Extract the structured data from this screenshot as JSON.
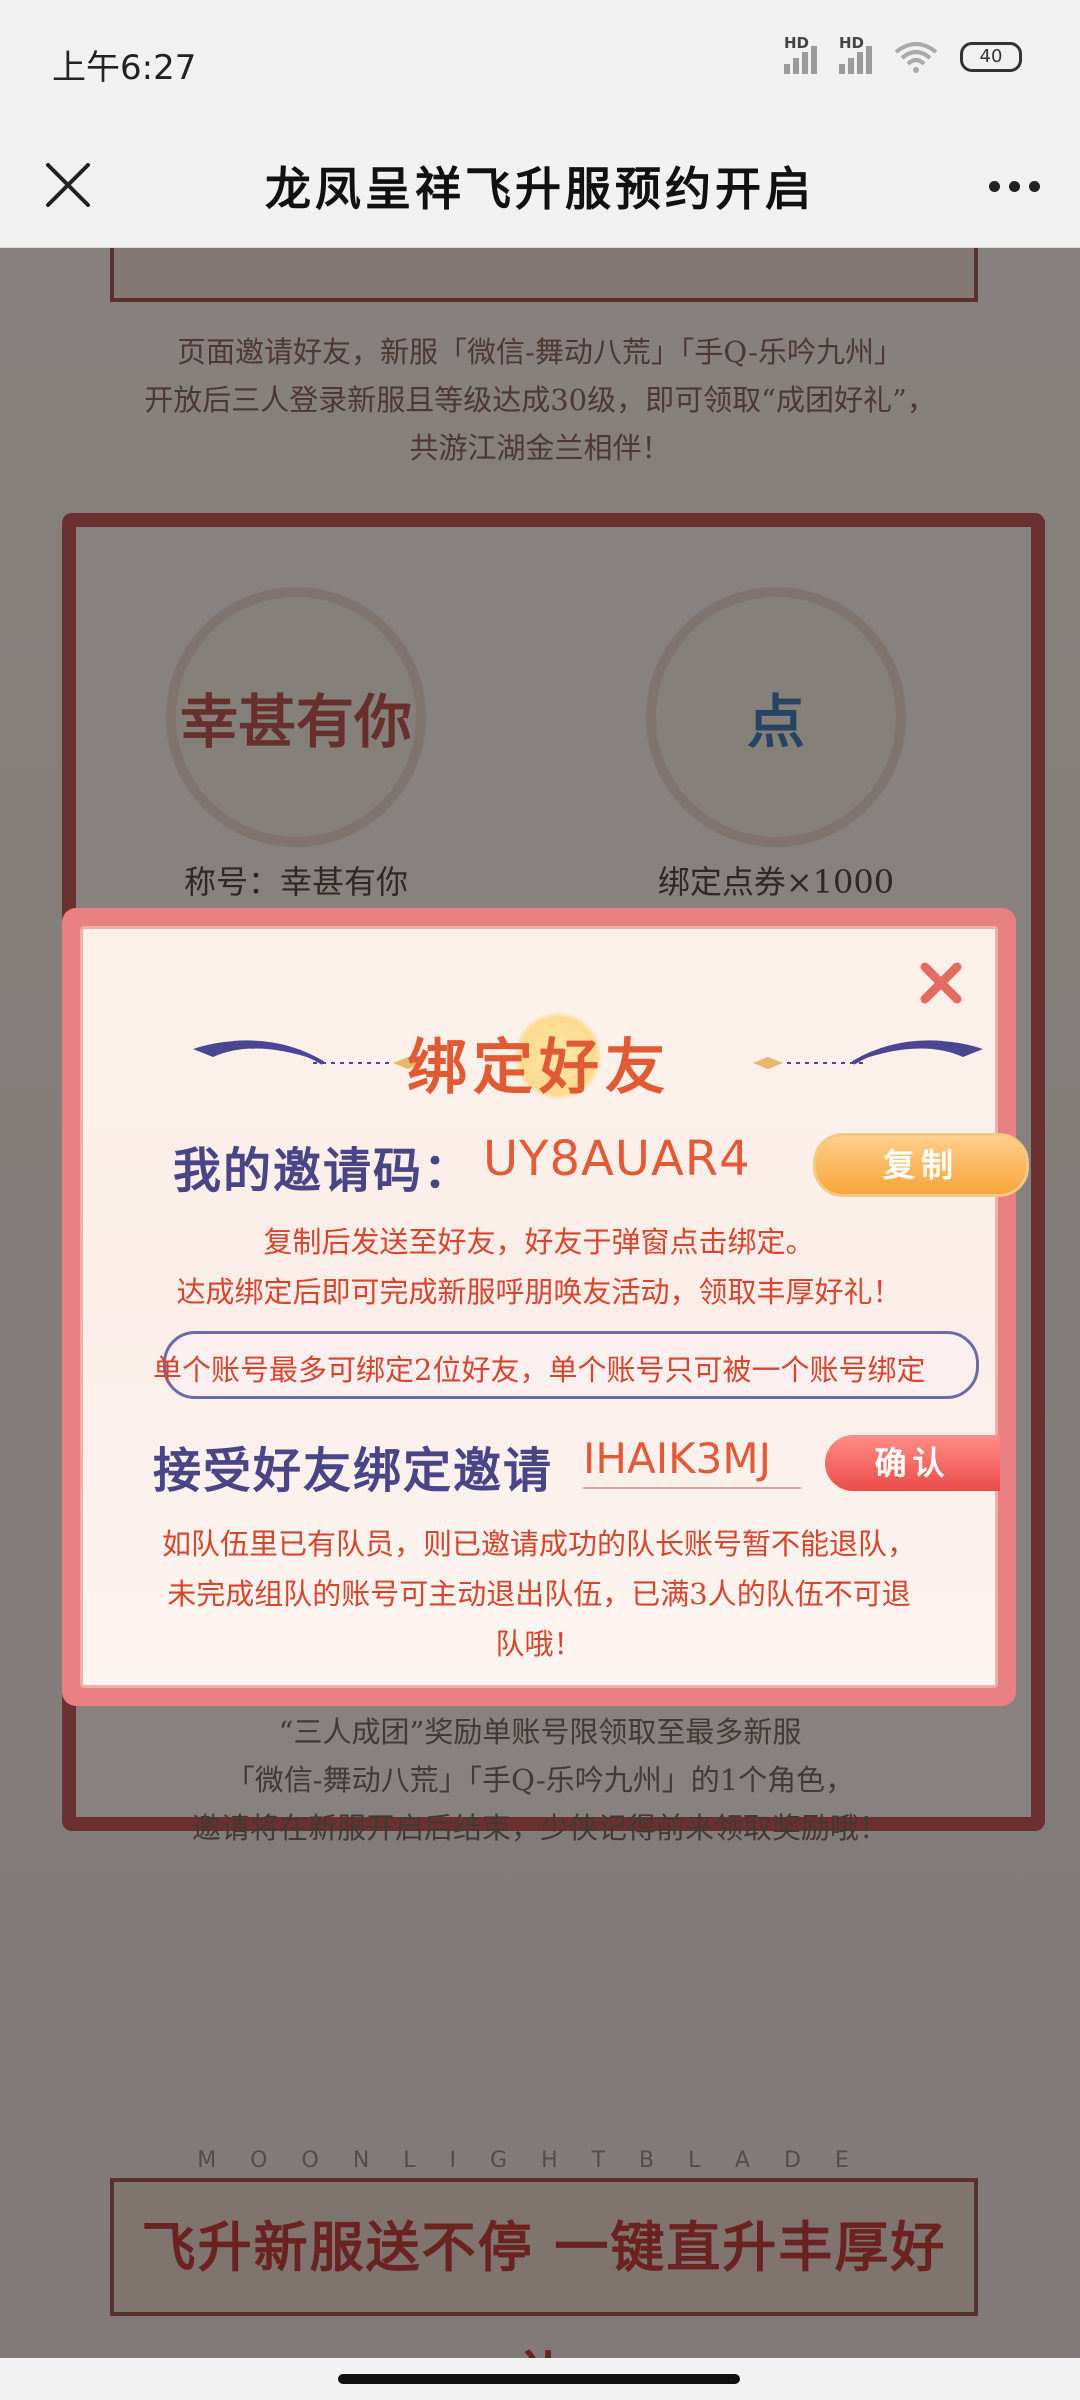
{
  "status_bar": {
    "time": "上午6:27",
    "signal1_label": "HD",
    "signal2_label": "HD",
    "battery": "40"
  },
  "nav": {
    "title": "龙凤呈祥飞升服预约开启"
  },
  "background_page": {
    "intro_lines": [
      "页面邀请好友，新服「微信-舞动八荒」「手Q-乐吟九州」",
      "开放后三人登录新服且等级达成30级，即可领取“成团好礼”，",
      "共游江湖金兰相伴！"
    ],
    "rewards": [
      {
        "icon_text": "幸甚有你",
        "label": "称号：幸甚有你"
      },
      {
        "icon_text": "点",
        "label": "绑定点券×1000"
      }
    ],
    "bottom_lines": [
      "“三人成团”奖励单账号限领取至最多新服",
      "「微信-舞动八荒」「手Q-乐吟九州」的1个角色，",
      "邀请将在新服开启后结束，少侠记得前来领取奖励哦！"
    ],
    "footer_letters": "MOONLIGHTBLADE",
    "footer_banner": "飞升新服送不停 一键直升丰厚好礼"
  },
  "modal": {
    "title": "绑定好友",
    "my_code_label": "我的邀请码：",
    "my_code_value": "UY8AUAR4",
    "copy_button": "复制",
    "desc_lines": [
      "复制后发送至好友，好友于弹窗点击绑定。",
      "达成绑定后即可完成新服呼朋唤友活动，领取丰厚好礼！"
    ],
    "rule": "单个账号最多可绑定2位好友，单个账号只可被一个账号绑定",
    "accept_label": "接受好友绑定邀请",
    "accept_value": "IHAIK3MJ",
    "confirm_button": "确认",
    "note_lines": [
      "如队伍里已有队员，则已邀请成功的队长账号暂不能退队，",
      "未完成组队的账号可主动退出队伍，已满3人的队伍不可退",
      "队哦！"
    ]
  }
}
